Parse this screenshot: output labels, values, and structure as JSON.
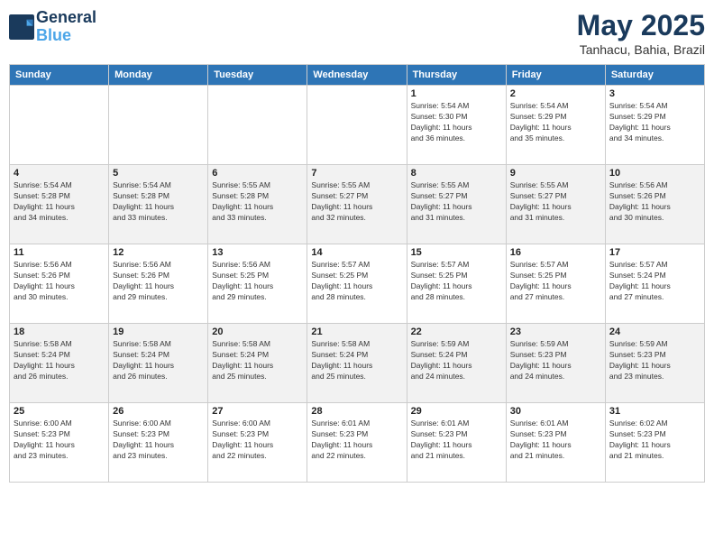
{
  "logo": {
    "line1": "General",
    "line2": "Blue"
  },
  "title": "May 2025",
  "subtitle": "Tanhacu, Bahia, Brazil",
  "days_of_week": [
    "Sunday",
    "Monday",
    "Tuesday",
    "Wednesday",
    "Thursday",
    "Friday",
    "Saturday"
  ],
  "weeks": [
    [
      {
        "day": "",
        "info": ""
      },
      {
        "day": "",
        "info": ""
      },
      {
        "day": "",
        "info": ""
      },
      {
        "day": "",
        "info": ""
      },
      {
        "day": "1",
        "info": "Sunrise: 5:54 AM\nSunset: 5:30 PM\nDaylight: 11 hours\nand 36 minutes."
      },
      {
        "day": "2",
        "info": "Sunrise: 5:54 AM\nSunset: 5:29 PM\nDaylight: 11 hours\nand 35 minutes."
      },
      {
        "day": "3",
        "info": "Sunrise: 5:54 AM\nSunset: 5:29 PM\nDaylight: 11 hours\nand 34 minutes."
      }
    ],
    [
      {
        "day": "4",
        "info": "Sunrise: 5:54 AM\nSunset: 5:28 PM\nDaylight: 11 hours\nand 34 minutes."
      },
      {
        "day": "5",
        "info": "Sunrise: 5:54 AM\nSunset: 5:28 PM\nDaylight: 11 hours\nand 33 minutes."
      },
      {
        "day": "6",
        "info": "Sunrise: 5:55 AM\nSunset: 5:28 PM\nDaylight: 11 hours\nand 33 minutes."
      },
      {
        "day": "7",
        "info": "Sunrise: 5:55 AM\nSunset: 5:27 PM\nDaylight: 11 hours\nand 32 minutes."
      },
      {
        "day": "8",
        "info": "Sunrise: 5:55 AM\nSunset: 5:27 PM\nDaylight: 11 hours\nand 31 minutes."
      },
      {
        "day": "9",
        "info": "Sunrise: 5:55 AM\nSunset: 5:27 PM\nDaylight: 11 hours\nand 31 minutes."
      },
      {
        "day": "10",
        "info": "Sunrise: 5:56 AM\nSunset: 5:26 PM\nDaylight: 11 hours\nand 30 minutes."
      }
    ],
    [
      {
        "day": "11",
        "info": "Sunrise: 5:56 AM\nSunset: 5:26 PM\nDaylight: 11 hours\nand 30 minutes."
      },
      {
        "day": "12",
        "info": "Sunrise: 5:56 AM\nSunset: 5:26 PM\nDaylight: 11 hours\nand 29 minutes."
      },
      {
        "day": "13",
        "info": "Sunrise: 5:56 AM\nSunset: 5:25 PM\nDaylight: 11 hours\nand 29 minutes."
      },
      {
        "day": "14",
        "info": "Sunrise: 5:57 AM\nSunset: 5:25 PM\nDaylight: 11 hours\nand 28 minutes."
      },
      {
        "day": "15",
        "info": "Sunrise: 5:57 AM\nSunset: 5:25 PM\nDaylight: 11 hours\nand 28 minutes."
      },
      {
        "day": "16",
        "info": "Sunrise: 5:57 AM\nSunset: 5:25 PM\nDaylight: 11 hours\nand 27 minutes."
      },
      {
        "day": "17",
        "info": "Sunrise: 5:57 AM\nSunset: 5:24 PM\nDaylight: 11 hours\nand 27 minutes."
      }
    ],
    [
      {
        "day": "18",
        "info": "Sunrise: 5:58 AM\nSunset: 5:24 PM\nDaylight: 11 hours\nand 26 minutes."
      },
      {
        "day": "19",
        "info": "Sunrise: 5:58 AM\nSunset: 5:24 PM\nDaylight: 11 hours\nand 26 minutes."
      },
      {
        "day": "20",
        "info": "Sunrise: 5:58 AM\nSunset: 5:24 PM\nDaylight: 11 hours\nand 25 minutes."
      },
      {
        "day": "21",
        "info": "Sunrise: 5:58 AM\nSunset: 5:24 PM\nDaylight: 11 hours\nand 25 minutes."
      },
      {
        "day": "22",
        "info": "Sunrise: 5:59 AM\nSunset: 5:24 PM\nDaylight: 11 hours\nand 24 minutes."
      },
      {
        "day": "23",
        "info": "Sunrise: 5:59 AM\nSunset: 5:23 PM\nDaylight: 11 hours\nand 24 minutes."
      },
      {
        "day": "24",
        "info": "Sunrise: 5:59 AM\nSunset: 5:23 PM\nDaylight: 11 hours\nand 23 minutes."
      }
    ],
    [
      {
        "day": "25",
        "info": "Sunrise: 6:00 AM\nSunset: 5:23 PM\nDaylight: 11 hours\nand 23 minutes."
      },
      {
        "day": "26",
        "info": "Sunrise: 6:00 AM\nSunset: 5:23 PM\nDaylight: 11 hours\nand 23 minutes."
      },
      {
        "day": "27",
        "info": "Sunrise: 6:00 AM\nSunset: 5:23 PM\nDaylight: 11 hours\nand 22 minutes."
      },
      {
        "day": "28",
        "info": "Sunrise: 6:01 AM\nSunset: 5:23 PM\nDaylight: 11 hours\nand 22 minutes."
      },
      {
        "day": "29",
        "info": "Sunrise: 6:01 AM\nSunset: 5:23 PM\nDaylight: 11 hours\nand 21 minutes."
      },
      {
        "day": "30",
        "info": "Sunrise: 6:01 AM\nSunset: 5:23 PM\nDaylight: 11 hours\nand 21 minutes."
      },
      {
        "day": "31",
        "info": "Sunrise: 6:02 AM\nSunset: 5:23 PM\nDaylight: 11 hours\nand 21 minutes."
      }
    ]
  ]
}
